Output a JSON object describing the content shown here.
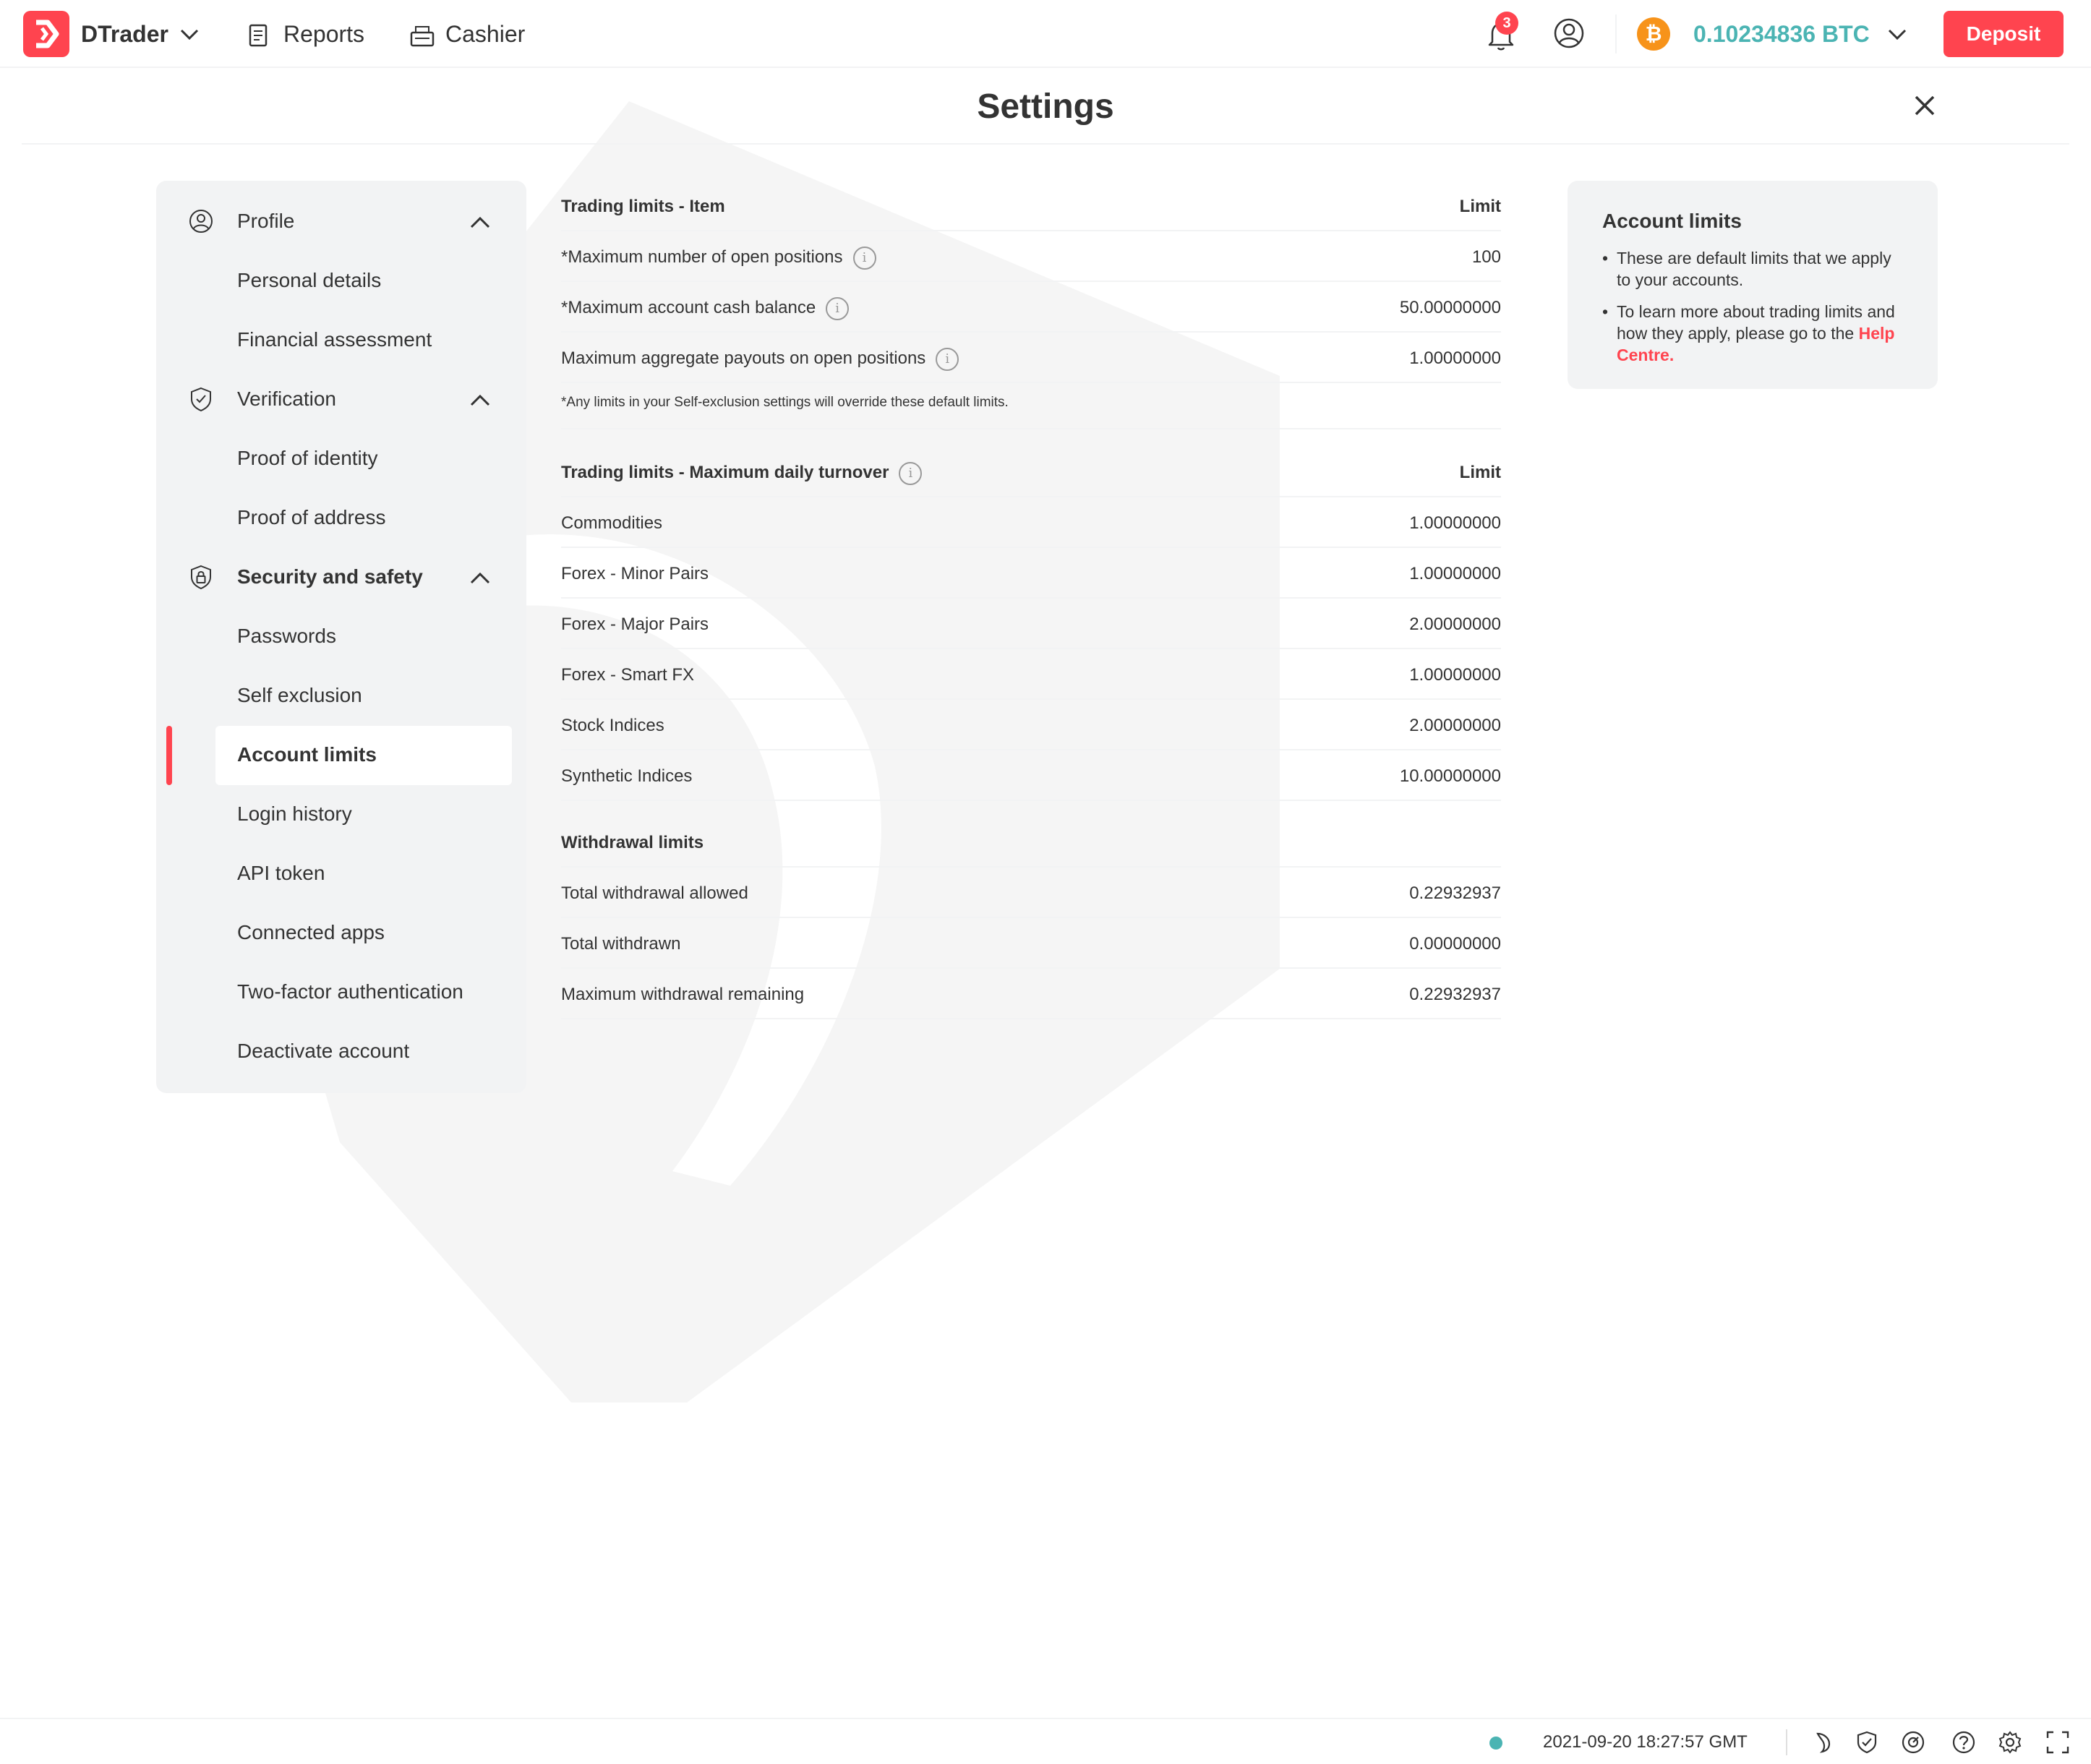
{
  "header": {
    "app_name": "DTrader",
    "nav": {
      "reports": "Reports",
      "cashier": "Cashier"
    },
    "notifications_count": "3",
    "balance": "0.10234836 BTC",
    "currency_glyph": "₿",
    "deposit_label": "Deposit"
  },
  "page": {
    "title": "Settings"
  },
  "sidebar": {
    "groups": [
      {
        "label": "Profile",
        "icon": "profile-icon",
        "items": [
          "Personal details",
          "Financial assessment"
        ]
      },
      {
        "label": "Verification",
        "icon": "shield-check-icon",
        "items": [
          "Proof of identity",
          "Proof of address"
        ]
      },
      {
        "label": "Security and safety",
        "icon": "lock-shield-icon",
        "items": [
          "Passwords",
          "Self exclusion",
          "Account limits",
          "Login history",
          "API token",
          "Connected apps",
          "Two-factor authentication",
          "Deactivate account"
        ]
      }
    ],
    "active_item": "Account limits"
  },
  "trading_limits": {
    "header": {
      "item": "Trading limits - Item",
      "limit": "Limit"
    },
    "rows": [
      {
        "label": "*Maximum number of open positions",
        "value": "100",
        "info": true
      },
      {
        "label": "*Maximum account cash balance",
        "value": "50.00000000",
        "info": true
      },
      {
        "label": "Maximum aggregate payouts on open positions",
        "value": "1.00000000",
        "info": true
      }
    ],
    "note": "*Any limits in your Self-exclusion settings will override these default limits."
  },
  "daily_turnover": {
    "header": {
      "item": "Trading limits - Maximum daily turnover",
      "limit": "Limit"
    },
    "rows": [
      {
        "label": "Commodities",
        "value": "1.00000000"
      },
      {
        "label": "Forex - Minor Pairs",
        "value": "1.00000000"
      },
      {
        "label": "Forex - Major Pairs",
        "value": "2.00000000"
      },
      {
        "label": "Forex - Smart FX",
        "value": "1.00000000"
      },
      {
        "label": "Stock Indices",
        "value": "2.00000000"
      },
      {
        "label": "Synthetic Indices",
        "value": "10.00000000"
      }
    ]
  },
  "withdrawal_limits": {
    "header": "Withdrawal limits",
    "rows": [
      {
        "label": "Total withdrawal allowed",
        "value": "0.22932937"
      },
      {
        "label": "Total withdrawn",
        "value": "0.00000000"
      },
      {
        "label": "Maximum withdrawal remaining",
        "value": "0.22932937"
      }
    ]
  },
  "info_panel": {
    "title": "Account limits",
    "bullet1": "These are default limits that we apply to your accounts.",
    "bullet2_prefix": "To learn more about trading limits and how they apply, please go to the ",
    "bullet2_link": "Help Centre."
  },
  "footer": {
    "status_color": "#4bb4b3",
    "timestamp": "2021-09-20 18:27:57 GMT",
    "icons": [
      "dark-mode-icon",
      "responsible-trading-icon",
      "network-status-icon",
      "help-icon",
      "settings-icon",
      "fullscreen-icon"
    ]
  },
  "colors": {
    "brand": "#ff444f",
    "accent_teal": "#4bb4b3",
    "panel_bg": "#f2f3f4",
    "btc": "#f7931a"
  }
}
